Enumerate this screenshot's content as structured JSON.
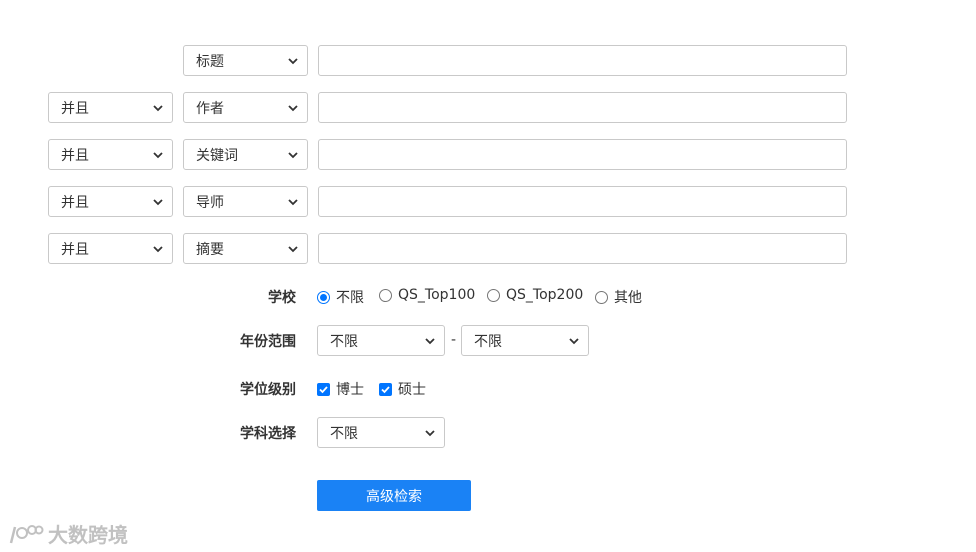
{
  "rows": [
    {
      "logic": "",
      "field": "标题"
    },
    {
      "logic": "并且",
      "field": "作者"
    },
    {
      "logic": "并且",
      "field": "关键词"
    },
    {
      "logic": "并且",
      "field": "导师"
    },
    {
      "logic": "并且",
      "field": "摘要"
    }
  ],
  "school": {
    "label": "学校",
    "options": [
      "不限",
      "QS_Top100",
      "QS_Top200",
      "其他"
    ],
    "selected": "不限"
  },
  "year": {
    "label": "年份范围",
    "from": "不限",
    "separator": "-",
    "to": "不限"
  },
  "degree": {
    "label": "学位级别",
    "options": [
      "博士",
      "硕士"
    ],
    "checked": [
      "博士",
      "硕士"
    ]
  },
  "subject": {
    "label": "学科选择",
    "value": "不限"
  },
  "search_button": "高级检索",
  "watermark": "大数跨境",
  "colors": {
    "accent": "#1a82f5",
    "check": "#0075ff"
  }
}
